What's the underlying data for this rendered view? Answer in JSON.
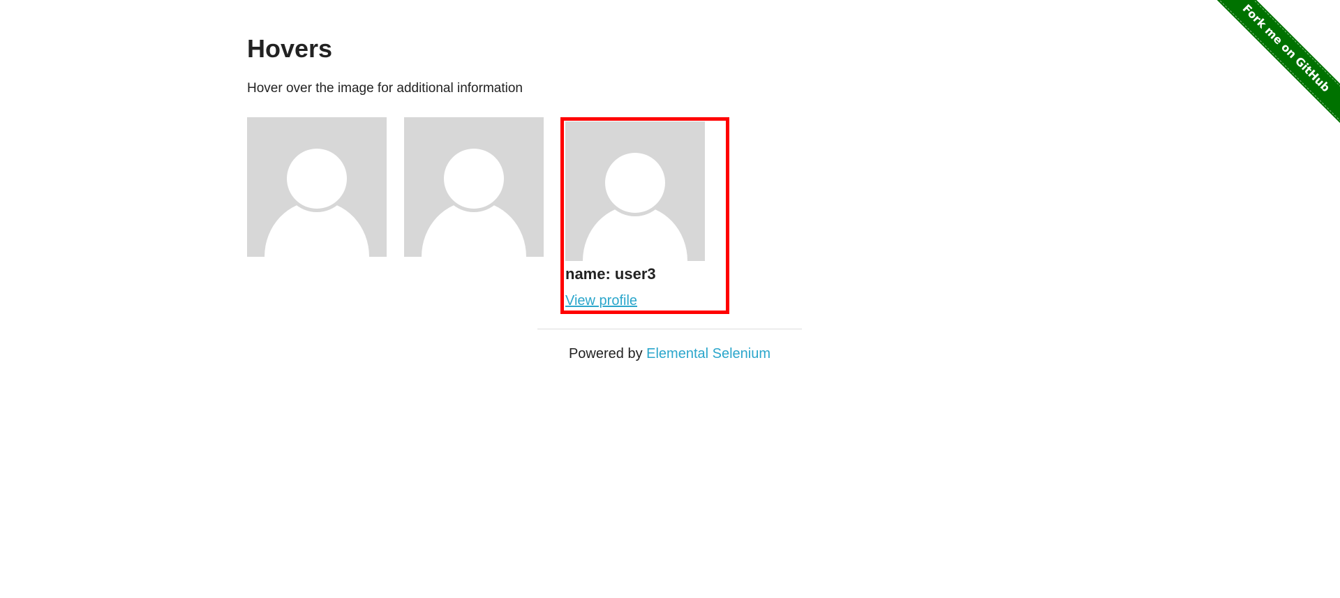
{
  "page": {
    "title": "Hovers",
    "subtitle": "Hover over the image for additional information"
  },
  "figures": [
    {
      "avatar_icon": "user-avatar-icon"
    },
    {
      "avatar_icon": "user-avatar-icon"
    },
    {
      "avatar_icon": "user-avatar-icon",
      "caption_name": "name: user3",
      "caption_link": "View profile"
    }
  ],
  "footer": {
    "prefix": "Powered by ",
    "link_text": "Elemental Selenium"
  },
  "ribbon": {
    "label": "Fork me on GitHub"
  },
  "colors": {
    "link": "#2ba6cb",
    "ribbon": "#007200",
    "highlight": "#ff0000",
    "avatar_bg": "#d7d7d7"
  }
}
